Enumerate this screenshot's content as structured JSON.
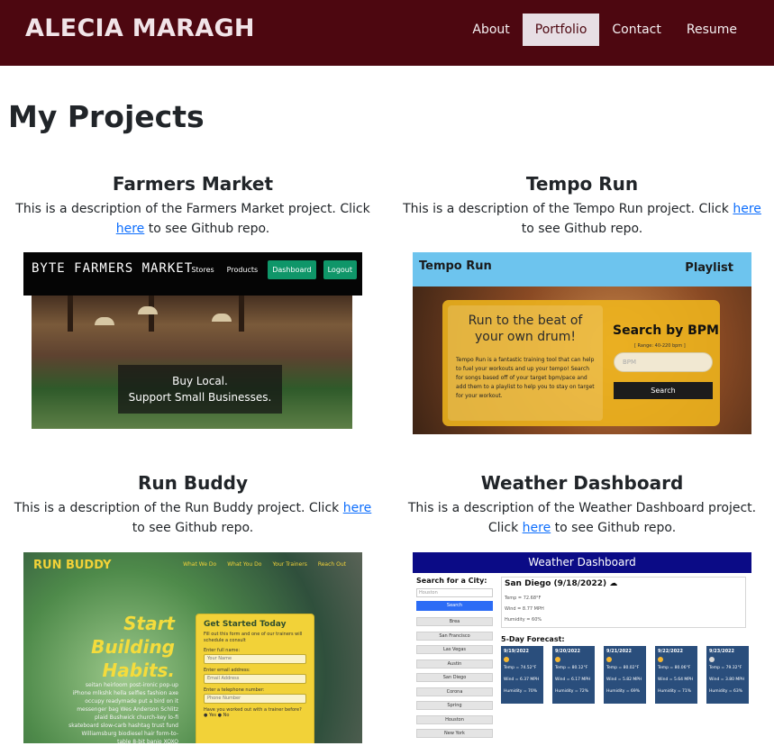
{
  "header": {
    "brand": "ALECIA MARAGH",
    "nav": [
      "About",
      "Portfolio",
      "Contact",
      "Resume"
    ],
    "active": "Portfolio"
  },
  "main": {
    "title": "My Projects",
    "projects": [
      {
        "title": "Farmers Market",
        "desc_before": "This is a description of the Farmers Market project. Click ",
        "link": "here",
        "desc_after": " to see Github repo.",
        "screenshot": {
          "logo": "BYTE FARMERS MARKET",
          "nav": [
            "Stores",
            "Products",
            "Dashboard",
            "Logout"
          ],
          "caption_1": "Buy Local.",
          "caption_2": "Support Small Businesses."
        }
      },
      {
        "title": "Tempo Run",
        "desc_before": "This is a description of the Tempo Run project. Click ",
        "link": "here",
        "desc_after": " to see Github repo.",
        "screenshot": {
          "brand": "Tempo Run",
          "playlist": "Playlist",
          "headline": "Run to the beat of your own drum!",
          "description": "Tempo Run is a fantastic training tool that can help to fuel your workouts and up your tempo! Search for songs based off of your target bpm/pace and add them to a playlist to help you to stay on target for your workout.",
          "search_title": "Search by BPM",
          "range": "[ Range: 40-220 bpm ]",
          "placeholder": "BPM",
          "button": "Search"
        }
      },
      {
        "title": "Run Buddy",
        "desc_before": "This is a description of the Run Buddy project. Click ",
        "link": "here",
        "desc_after": " to see Github repo.",
        "screenshot": {
          "logo": "RUN BUDDY",
          "nav": [
            "What We Do",
            "What You Do",
            "Your Trainers",
            "Reach Out"
          ],
          "hero": [
            "Start",
            "Building",
            "Habits."
          ],
          "filler": "seitan heirloom post-ironic pop-up iPhone mlkshk hella selfies fashion axe occupy readymade put a bird on it messenger bag Wes Anderson Schlitz plaid Bushwick church-key lo-fi skateboard slow-carb hashtag trust fund Williamsburg biodiesel hair form-to-table 8-bit banjo XOXO",
          "form_title": "Get Started Today",
          "form_sub": "Fill out this form and one of our trainers will schedule a consult",
          "label_name": "Enter full name:",
          "ph_name": "Your Name",
          "label_email": "Enter email address:",
          "ph_email": "Email Address",
          "label_phone": "Enter a telephone number:",
          "ph_phone": "Phone Number",
          "question": "Have you worked out with a trainer before?",
          "yes": "Yes",
          "no": "No"
        }
      },
      {
        "title": "Weather Dashboard",
        "desc_before": "This is a description of the Weather Dashboard project. Click ",
        "link": "here",
        "desc_after": " to see Github repo.",
        "screenshot": {
          "title": "Weather Dashboard",
          "search_label": "Search for a City:",
          "input": "Houston",
          "search_button": "Search",
          "history": [
            "Brea",
            "San Francisco",
            "Las Vegas",
            "Austin",
            "San Diego",
            "Corona",
            "Spring",
            "Houston",
            "New York"
          ],
          "current_city": "San Diego (9/18/2022)",
          "current_temp": "Temp = 72.68°F",
          "current_wind": "Wind = 8.77 MPH",
          "current_humidity": "Humidity = 60%",
          "forecast_title": "5-Day Forecast:",
          "forecast": [
            {
              "date": "9/19/2022",
              "temp": "Temp = 74.52°F",
              "wind": "Wind = 6.37 MPH",
              "humidity": "Humidity = 70%"
            },
            {
              "date": "9/20/2022",
              "temp": "Temp = 80.12°F",
              "wind": "Wind = 6.17 MPH",
              "humidity": "Humidity = 72%"
            },
            {
              "date": "9/21/2022",
              "temp": "Temp = 80.02°F",
              "wind": "Wind = 5.82 MPH",
              "humidity": "Humidity = 69%"
            },
            {
              "date": "9/22/2022",
              "temp": "Temp = 80.06°F",
              "wind": "Wind = 5.64 MPH",
              "humidity": "Humidity = 71%"
            },
            {
              "date": "9/23/2022",
              "temp": "Temp = 79.32°F",
              "wind": "Wind = 3.80 MPH",
              "humidity": "Humidity = 63%"
            }
          ]
        }
      }
    ]
  }
}
